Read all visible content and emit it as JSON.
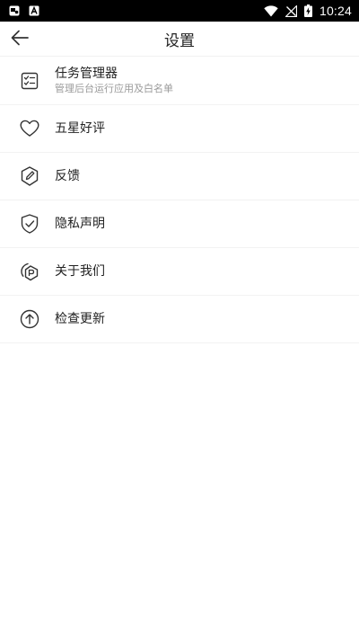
{
  "status_bar": {
    "notification_icons": [
      "gallery-notification-icon",
      "app-notification-icon"
    ],
    "system_icons": [
      "wifi-icon",
      "no-signal-icon",
      "battery-charging-icon"
    ],
    "time": "10:24"
  },
  "header": {
    "title": "设置",
    "back_icon": "arrow-left-icon"
  },
  "settings": {
    "items": [
      {
        "label": "任务管理器",
        "sublabel": "管理后台运行应用及白名单",
        "icon": "checklist-icon"
      },
      {
        "label": "五星好评",
        "icon": "heart-icon"
      },
      {
        "label": "反馈",
        "icon": "feedback-pen-icon"
      },
      {
        "label": "隐私声明",
        "icon": "shield-check-icon"
      },
      {
        "label": "关于我们",
        "icon": "about-badge-icon"
      },
      {
        "label": "检查更新",
        "icon": "arrow-up-circle-icon"
      }
    ]
  },
  "colors": {
    "status_bar_bg": "#000000",
    "background": "#ffffff",
    "text_primary": "#222222",
    "text_secondary": "#9a9a9a",
    "divider": "#f2f2f2",
    "icon_stroke": "#333333"
  }
}
